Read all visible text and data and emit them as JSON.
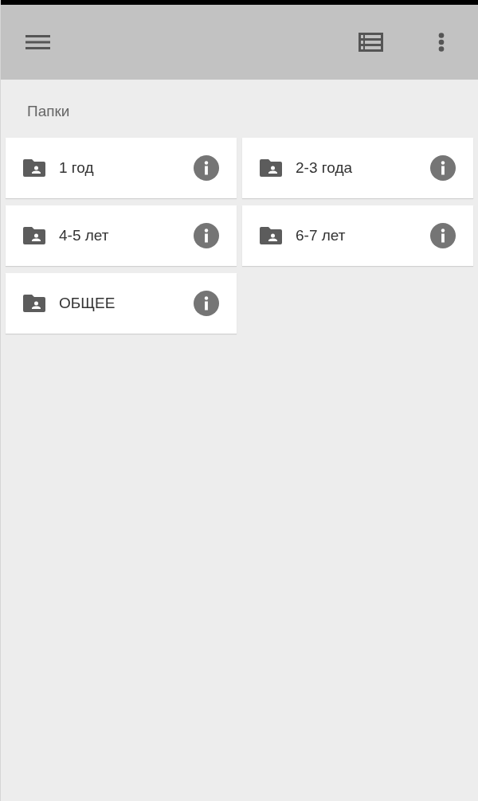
{
  "section": {
    "title": "Папки"
  },
  "folders": [
    {
      "name": "1 год"
    },
    {
      "name": "2-3 года"
    },
    {
      "name": "4-5 лет"
    },
    {
      "name": "6-7 лет"
    },
    {
      "name": "ОБЩЕЕ"
    }
  ]
}
